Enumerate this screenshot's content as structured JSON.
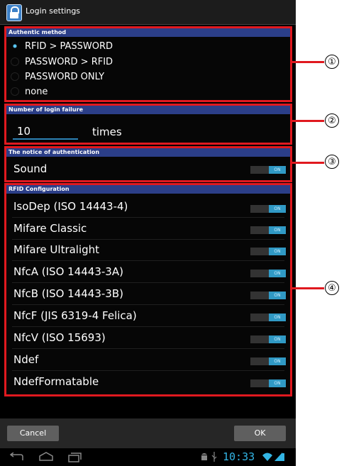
{
  "window": {
    "title": "Login settings"
  },
  "authentic_method": {
    "header": "Authentic method",
    "options": [
      {
        "label": "RFID > PASSWORD",
        "selected": true
      },
      {
        "label": "PASSWORD > RFID",
        "selected": false
      },
      {
        "label": "PASSWORD ONLY",
        "selected": false
      },
      {
        "label": "none",
        "selected": false
      }
    ]
  },
  "login_failure": {
    "header": "Number of login failure",
    "value": "10",
    "unit": "times"
  },
  "notice": {
    "header": "The notice of authentication",
    "items": [
      {
        "label": "Sound",
        "state": "ON"
      }
    ]
  },
  "rfid": {
    "header": "RFID Configuration",
    "items": [
      {
        "label": "IsoDep (ISO 14443-4)",
        "state": "ON"
      },
      {
        "label": "Mifare Classic",
        "state": "ON"
      },
      {
        "label": "Mifare Ultralight",
        "state": "ON"
      },
      {
        "label": "NfcA (ISO 14443-3A)",
        "state": "ON"
      },
      {
        "label": "NfcB (ISO 14443-3B)",
        "state": "ON"
      },
      {
        "label": "NfcF (JIS 6319-4 Felica)",
        "state": "ON"
      },
      {
        "label": "NfcV (ISO 15693)",
        "state": "ON"
      },
      {
        "label": "Ndef",
        "state": "ON"
      },
      {
        "label": "NdefFormatable",
        "state": "ON"
      }
    ]
  },
  "buttons": {
    "cancel": "Cancel",
    "ok": "OK"
  },
  "status": {
    "time": "10:33"
  },
  "callouts": [
    "①",
    "②",
    "③",
    "④"
  ],
  "colors": {
    "highlight": "#e0191f",
    "accent": "#3099c5",
    "section_header": "#2b3e88"
  },
  "icons": {
    "title": "lock-icon",
    "nav": [
      "back-icon",
      "home-icon",
      "recent-apps-icon"
    ],
    "status": [
      "android-icon",
      "usb-icon",
      "wifi-icon",
      "battery-icon"
    ]
  }
}
